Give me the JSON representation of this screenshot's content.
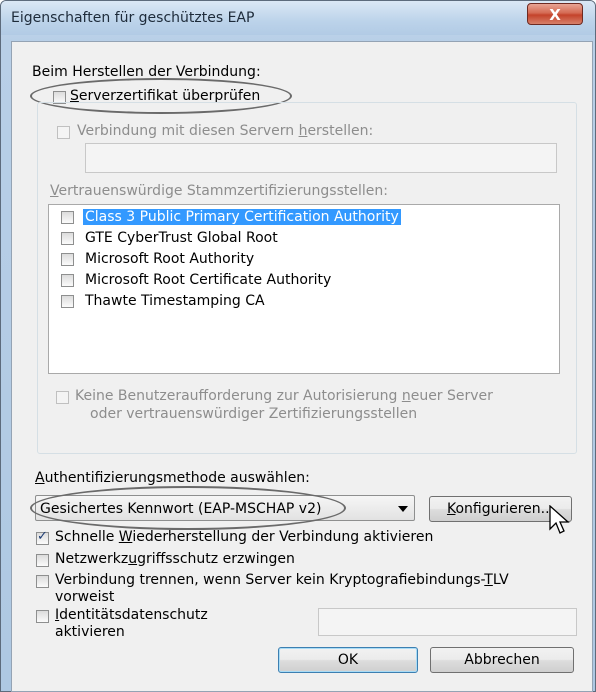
{
  "window": {
    "title": "Eigenschaften für geschütztes EAP",
    "close_symbol": "X"
  },
  "connection_section": {
    "label": "Beim Herstellen der Verbindung:",
    "verify_cert": {
      "label_prefix": "",
      "accel": "S",
      "label_rest": "erverzertifikat überprüfen",
      "checked": false
    },
    "connect_servers": {
      "label_prefix": "Verbindung mit diesen Servern ",
      "accel": "h",
      "label_rest": "erstellen:",
      "checked": false,
      "enabled": false,
      "value": ""
    },
    "trusted_roots": {
      "label_prefix": "",
      "accel": "V",
      "label_rest": "ertrauenswürdige Stammzertifizierungsstellen:",
      "items": [
        {
          "label": "Class 3 Public Primary Certification Authority",
          "checked": false,
          "selected": true
        },
        {
          "label": "GTE CyberTrust Global Root",
          "checked": false,
          "selected": false
        },
        {
          "label": "Microsoft Root Authority",
          "checked": false,
          "selected": false
        },
        {
          "label": "Microsoft Root Certificate Authority",
          "checked": false,
          "selected": false
        },
        {
          "label": "Thawte Timestamping CA",
          "checked": false,
          "selected": false
        }
      ]
    },
    "no_prompt": {
      "line1_prefix": "Keine Benutzeraufforderung zur Autorisierung ",
      "line1_accel": "n",
      "line1_rest": "euer Server",
      "line2": "oder vertrauenswürdiger Zertifizierungsstellen",
      "checked": false,
      "enabled": false
    }
  },
  "auth": {
    "label_prefix": "",
    "accel": "A",
    "label_rest": "uthentifizierungsmethode auswählen:",
    "method_selected": "Gesichertes Kennwort (EAP-MSCHAP v2)",
    "configure_prefix": "",
    "configure_accel": "K",
    "configure_rest": "onfigurieren..."
  },
  "options": {
    "fast_reconnect": {
      "prefix": "Schnelle ",
      "accel": "W",
      "rest": "iederherstellung der Verbindung aktivieren",
      "checked": true
    },
    "nap": {
      "prefix": "Netzwerkz",
      "accel": "u",
      "rest": "griffsschutz erzwingen",
      "checked": false
    },
    "crypto_tlv": {
      "prefix": "Verbindung trennen, wenn Server kein Kryptografiebindungs-",
      "accel": "T",
      "rest": "LV",
      "line2": "vorweist",
      "checked": false
    },
    "identity_privacy": {
      "prefix": "",
      "accel": "I",
      "rest": "dentitätsdatenschutz",
      "line2": "aktivieren",
      "checked": false,
      "value": ""
    }
  },
  "buttons": {
    "ok": "OK",
    "cancel": "Abbrechen"
  },
  "colors": {
    "selection": "#3399ff",
    "accent": "#3c7fb1"
  }
}
